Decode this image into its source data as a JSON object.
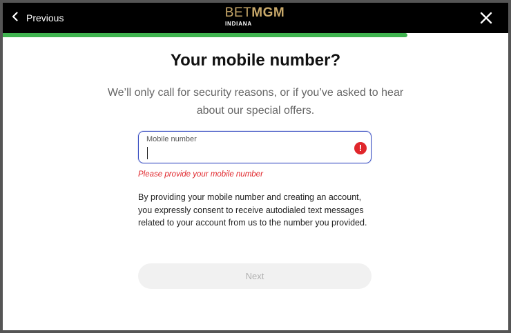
{
  "header": {
    "previous_label": "Previous",
    "logo_bet": "BET",
    "logo_mgm": "MGM",
    "logo_state": "INDIANA",
    "close_icon": "close-icon",
    "back_icon": "chevron-left-icon"
  },
  "progress": {
    "fraction": 0.8,
    "color": "#3fb34f"
  },
  "form": {
    "title_part1": "Your mobile ",
    "title_bold": "number",
    "title_part2": "?",
    "subtitle": "We’ll only call for security reasons, or if you’ve asked to hear about our special offers.",
    "field_label": "Mobile number",
    "field_value": "",
    "error_icon_glyph": "!",
    "error_message": "Please provide your mobile number",
    "consent_text": "By providing your mobile number and creating an account, you expressly consent to receive autodialed text messages related to your account from us to the number you provided.",
    "next_label": "Next"
  },
  "colors": {
    "accent_gold": "#c9a96a",
    "input_focus": "#3a4fc2",
    "error": "#e0262b"
  }
}
